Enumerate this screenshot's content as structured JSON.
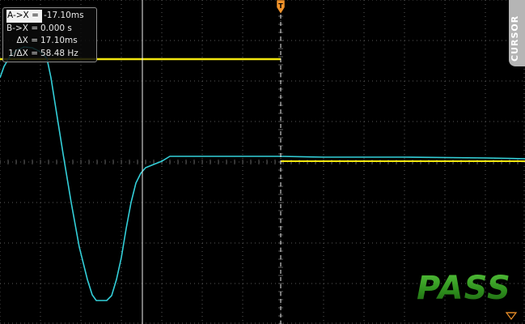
{
  "cursor_readout": {
    "rows": [
      {
        "label": "A->X =",
        "value": "-17.10ms",
        "selected": true
      },
      {
        "label": "B->X =",
        "value": "0.000 s",
        "selected": false
      },
      {
        "label": "ΔX =",
        "value": "17.10ms",
        "selected": false
      },
      {
        "label": "1/ΔX =",
        "value": "58.48 Hz",
        "selected": false
      }
    ]
  },
  "menu_tab": {
    "label": "CURSOR"
  },
  "result": {
    "label": "PASS"
  },
  "colors": {
    "background": "#000000",
    "grid": "#5a5a5a",
    "channel1": "#f2e60f",
    "channel2": "#33cfd9",
    "cursor_line": "#f0f0f0",
    "trigger_marker": "#f0922a",
    "pass_text": "#3aa826",
    "menu_tab": "#b5b5b5"
  },
  "icons": {
    "trigger_marker": "trigger-position-arrow",
    "corner_marker": "outline-down-arrow"
  }
}
